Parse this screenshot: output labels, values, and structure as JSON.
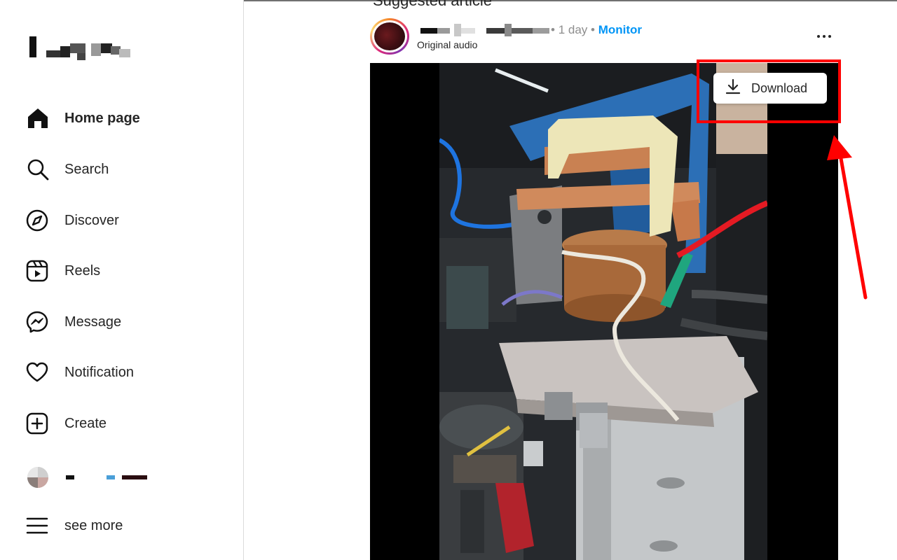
{
  "sidebar": {
    "items": [
      {
        "label": "Home page",
        "icon": "home-icon",
        "active": true
      },
      {
        "label": "Search",
        "icon": "search-icon"
      },
      {
        "label": "Discover",
        "icon": "compass-icon"
      },
      {
        "label": "Reels",
        "icon": "reels-icon"
      },
      {
        "label": "Message",
        "icon": "messenger-icon"
      },
      {
        "label": "Notification",
        "icon": "heart-icon"
      },
      {
        "label": "Create",
        "icon": "plus-square-icon"
      },
      {
        "label": "see more",
        "icon": "menu-icon"
      }
    ]
  },
  "post": {
    "section_title": "Suggested article",
    "time": "1 day",
    "separator": "•",
    "follow_label": "Monitor",
    "audio": "Original audio"
  },
  "download": {
    "label": "Download"
  },
  "colors": {
    "follow": "#0095f6",
    "highlight": "#ff0000",
    "text": "#262626"
  }
}
